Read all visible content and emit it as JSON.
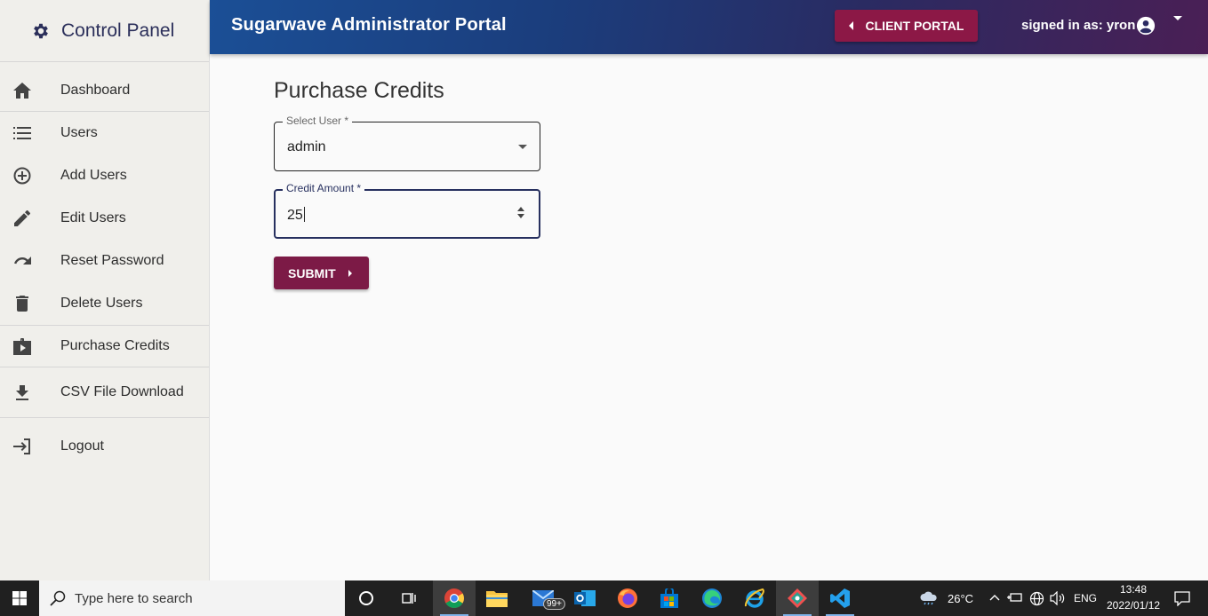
{
  "sidebar": {
    "title": "Control Panel",
    "items": [
      {
        "label": "Dashboard",
        "icon": "home-icon"
      },
      {
        "label": "Users",
        "icon": "list-icon"
      },
      {
        "label": "Add Users",
        "icon": "add-circle-icon"
      },
      {
        "label": "Edit Users",
        "icon": "pencil-icon"
      },
      {
        "label": "Reset Password",
        "icon": "redo-icon"
      },
      {
        "label": "Delete Users",
        "icon": "trash-icon"
      },
      {
        "label": "Purchase Credits",
        "icon": "briefcase-play-icon"
      },
      {
        "label": "CSV File Download",
        "icon": "download-icon"
      },
      {
        "label": "Logout",
        "icon": "logout-icon"
      }
    ]
  },
  "header": {
    "title": "Sugarwave Administrator Portal",
    "client_portal": "CLIENT PORTAL",
    "signed_in": "signed in as: yron"
  },
  "main": {
    "title": "Purchase Credits",
    "select_user": {
      "label": "Select User *",
      "value": "admin"
    },
    "credit_amount": {
      "label": "Credit Amount *",
      "value": "25"
    },
    "submit": "SUBMIT"
  },
  "taskbar": {
    "search_placeholder": "Type here to search",
    "mail_badge": "99+",
    "weather": "26°C",
    "language": "ENG",
    "time": "13:48",
    "date": "2022/01/12"
  },
  "colors": {
    "accent": "#8c1846",
    "nav_text": "#2b2f5a",
    "header_start": "#1b4f96",
    "header_end": "#4a1f55"
  }
}
